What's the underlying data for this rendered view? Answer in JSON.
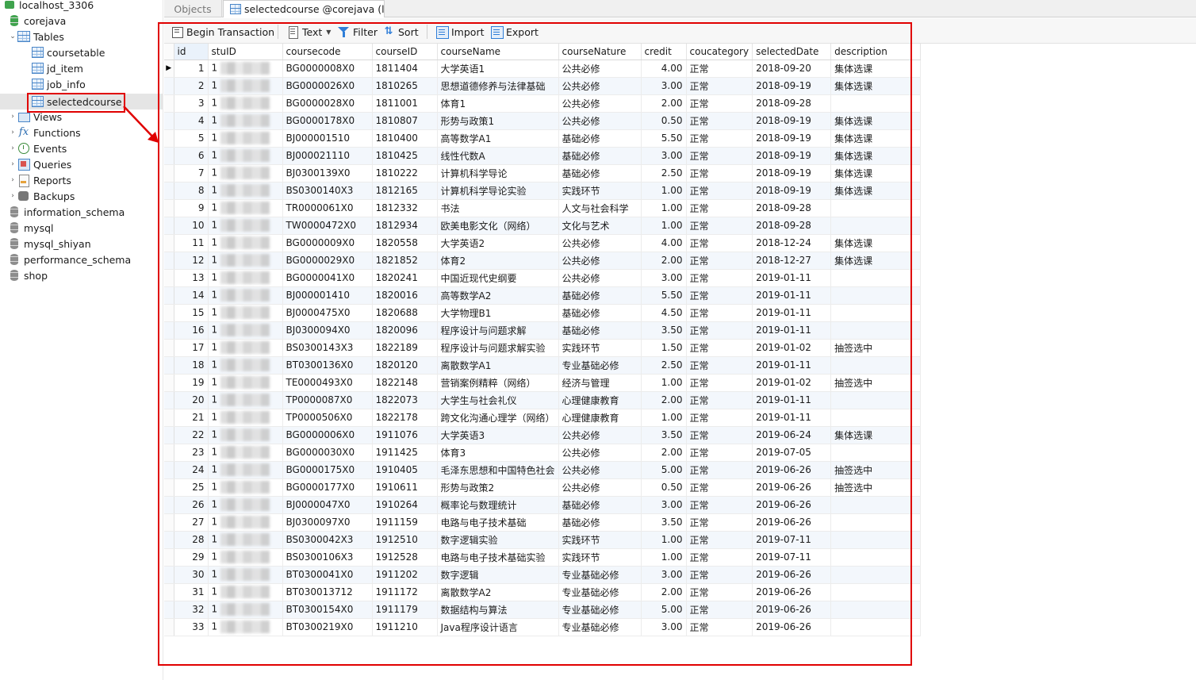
{
  "sidebar": {
    "server": "localhost_3306",
    "database": "corejava",
    "tables_label": "Tables",
    "tables": [
      "coursetable",
      "jd_item",
      "job_info",
      "selectedcourse"
    ],
    "sections": [
      "Views",
      "Functions",
      "Events",
      "Queries",
      "Reports",
      "Backups"
    ],
    "other_databases": [
      "information_schema",
      "mysql",
      "mysql_shiyan",
      "performance_schema",
      "shop"
    ]
  },
  "tabs": {
    "objects": "Objects",
    "active": "selectedcourse @corejava (l..."
  },
  "toolbar": {
    "begin_transaction": "Begin Transaction",
    "text": "Text",
    "filter": "Filter",
    "sort": "Sort",
    "import": "Import",
    "export": "Export"
  },
  "grid": {
    "columns": [
      "id",
      "stuID",
      "coursecode",
      "courseID",
      "courseName",
      "courseNature",
      "credit",
      "coucategory",
      "selectedDate",
      "description"
    ],
    "rows": [
      [
        "1",
        "1",
        "BG0000008X0",
        "1811404",
        "大学英语1",
        "公共必修",
        "4.00",
        "正常",
        "2018-09-20",
        "集体选课"
      ],
      [
        "2",
        "1",
        "BG0000026X0",
        "1810265",
        "思想道德修养与法律基础",
        "公共必修",
        "3.00",
        "正常",
        "2018-09-19",
        "集体选课"
      ],
      [
        "3",
        "1",
        "BG0000028X0",
        "1811001",
        "体育1",
        "公共必修",
        "2.00",
        "正常",
        "2018-09-28",
        ""
      ],
      [
        "4",
        "1",
        "BG0000178X0",
        "1810807",
        "形势与政策1",
        "公共必修",
        "0.50",
        "正常",
        "2018-09-19",
        "集体选课"
      ],
      [
        "5",
        "1",
        "BJ000001510",
        "1810400",
        "高等数学A1",
        "基础必修",
        "5.50",
        "正常",
        "2018-09-19",
        "集体选课"
      ],
      [
        "6",
        "1",
        "BJ000021110",
        "1810425",
        "线性代数A",
        "基础必修",
        "3.00",
        "正常",
        "2018-09-19",
        "集体选课"
      ],
      [
        "7",
        "1",
        "BJ0300139X0",
        "1810222",
        "计算机科学导论",
        "基础必修",
        "2.50",
        "正常",
        "2018-09-19",
        "集体选课"
      ],
      [
        "8",
        "1",
        "BS0300140X3",
        "1812165",
        "计算机科学导论实验",
        "实践环节",
        "1.00",
        "正常",
        "2018-09-19",
        "集体选课"
      ],
      [
        "9",
        "1",
        "TR0000061X0",
        "1812332",
        "书法",
        "人文与社会科学",
        "1.00",
        "正常",
        "2018-09-28",
        ""
      ],
      [
        "10",
        "1",
        "TW0000472X0",
        "1812934",
        "欧美电影文化（网络）",
        "文化与艺术",
        "1.00",
        "正常",
        "2018-09-28",
        ""
      ],
      [
        "11",
        "1",
        "BG0000009X0",
        "1820558",
        "大学英语2",
        "公共必修",
        "4.00",
        "正常",
        "2018-12-24",
        "集体选课"
      ],
      [
        "12",
        "1",
        "BG0000029X0",
        "1821852",
        "体育2",
        "公共必修",
        "2.00",
        "正常",
        "2018-12-27",
        "集体选课"
      ],
      [
        "13",
        "1",
        "BG0000041X0",
        "1820241",
        "中国近现代史纲要",
        "公共必修",
        "3.00",
        "正常",
        "2019-01-11",
        ""
      ],
      [
        "14",
        "1",
        "BJ000001410",
        "1820016",
        "高等数学A2",
        "基础必修",
        "5.50",
        "正常",
        "2019-01-11",
        ""
      ],
      [
        "15",
        "1",
        "BJ0000475X0",
        "1820688",
        "大学物理B1",
        "基础必修",
        "4.50",
        "正常",
        "2019-01-11",
        ""
      ],
      [
        "16",
        "1",
        "BJ0300094X0",
        "1820096",
        "程序设计与问题求解",
        "基础必修",
        "3.50",
        "正常",
        "2019-01-11",
        ""
      ],
      [
        "17",
        "1",
        "BS0300143X3",
        "1822189",
        "程序设计与问题求解实验",
        "实践环节",
        "1.50",
        "正常",
        "2019-01-02",
        "抽签选中"
      ],
      [
        "18",
        "1",
        "BT0300136X0",
        "1820120",
        "离散数学A1",
        "专业基础必修",
        "2.50",
        "正常",
        "2019-01-11",
        ""
      ],
      [
        "19",
        "1",
        "TE0000493X0",
        "1822148",
        "营销案例精粹（网络）",
        "经济与管理",
        "1.00",
        "正常",
        "2019-01-02",
        "抽签选中"
      ],
      [
        "20",
        "1",
        "TP0000087X0",
        "1822073",
        "大学生与社会礼仪",
        "心理健康教育",
        "2.00",
        "正常",
        "2019-01-11",
        ""
      ],
      [
        "21",
        "1",
        "TP0000506X0",
        "1822178",
        "跨文化沟通心理学（网络）",
        "心理健康教育",
        "1.00",
        "正常",
        "2019-01-11",
        ""
      ],
      [
        "22",
        "1",
        "BG0000006X0",
        "1911076",
        "大学英语3",
        "公共必修",
        "3.50",
        "正常",
        "2019-06-24",
        "集体选课"
      ],
      [
        "23",
        "1",
        "BG0000030X0",
        "1911425",
        "体育3",
        "公共必修",
        "2.00",
        "正常",
        "2019-07-05",
        ""
      ],
      [
        "24",
        "1",
        "BG0000175X0",
        "1910405",
        "毛泽东思想和中国特色社会",
        "公共必修",
        "5.00",
        "正常",
        "2019-06-26",
        "抽签选中"
      ],
      [
        "25",
        "1",
        "BG0000177X0",
        "1910611",
        "形势与政策2",
        "公共必修",
        "0.50",
        "正常",
        "2019-06-26",
        "抽签选中"
      ],
      [
        "26",
        "1",
        "BJ0000047X0",
        "1910264",
        "概率论与数理统计",
        "基础必修",
        "3.00",
        "正常",
        "2019-06-26",
        ""
      ],
      [
        "27",
        "1",
        "BJ0300097X0",
        "1911159",
        "电路与电子技术基础",
        "基础必修",
        "3.50",
        "正常",
        "2019-06-26",
        ""
      ],
      [
        "28",
        "1",
        "BS0300042X3",
        "1912510",
        "数字逻辑实验",
        "实践环节",
        "1.00",
        "正常",
        "2019-07-11",
        ""
      ],
      [
        "29",
        "1",
        "BS0300106X3",
        "1912528",
        "电路与电子技术基础实验",
        "实践环节",
        "1.00",
        "正常",
        "2019-07-11",
        ""
      ],
      [
        "30",
        "1",
        "BT0300041X0",
        "1911202",
        "数字逻辑",
        "专业基础必修",
        "3.00",
        "正常",
        "2019-06-26",
        ""
      ],
      [
        "31",
        "1",
        "BT030013712",
        "1911172",
        "离散数学A2",
        "专业基础必修",
        "2.00",
        "正常",
        "2019-06-26",
        ""
      ],
      [
        "32",
        "1",
        "BT0300154X0",
        "1911179",
        "数据结构与算法",
        "专业基础必修",
        "5.00",
        "正常",
        "2019-06-26",
        ""
      ],
      [
        "33",
        "1",
        "BT0300219X0",
        "1911210",
        "Java程序设计语言",
        "专业基础必修",
        "3.00",
        "正常",
        "2019-06-26",
        ""
      ]
    ]
  },
  "colors": {
    "annotation_red": "#e00000",
    "selected_row": "#e5e5e5",
    "alt_row": "#f3f7fc",
    "accent_blue": "#2f7ed8"
  }
}
